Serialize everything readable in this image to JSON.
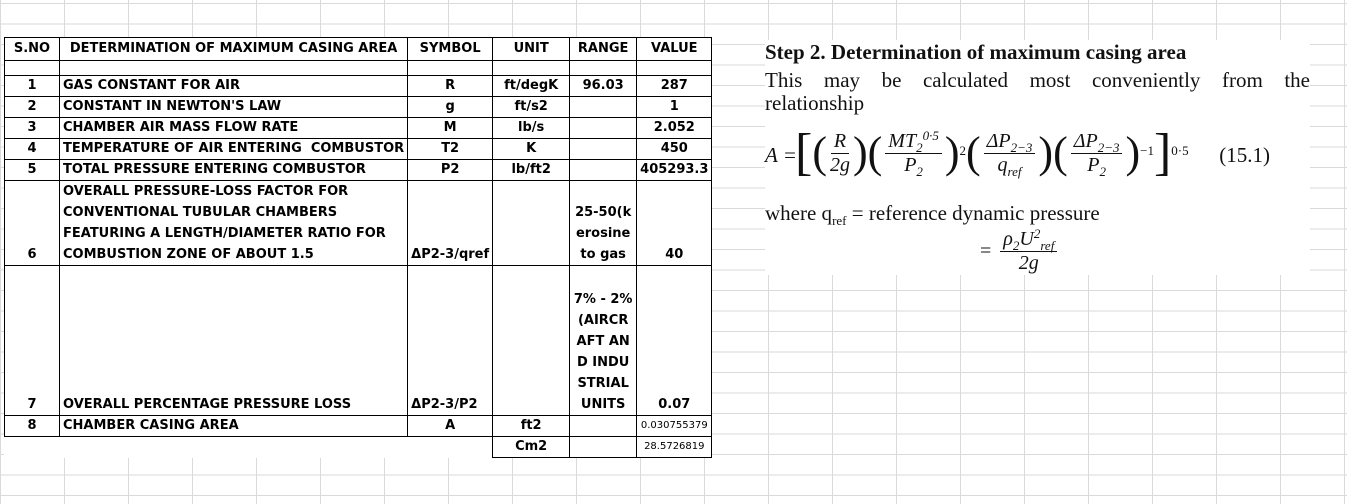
{
  "table": {
    "headers": {
      "sno": "S.NO",
      "description": "DETERMINATION OF MAXIMUM CASING AREA",
      "symbol": "SYMBOL",
      "unit": "UNIT",
      "range": "RANGE",
      "value": "VALUE"
    },
    "rows": [
      {
        "sno": "1",
        "description": "GAS CONSTANT FOR AIR",
        "symbol": "R",
        "unit": "ft/degK",
        "range": "96.03",
        "value": "287"
      },
      {
        "sno": "2",
        "description": "CONSTANT IN NEWTON'S LAW",
        "symbol": "g",
        "unit": "ft/s2",
        "range": "",
        "value": "1"
      },
      {
        "sno": "3",
        "description": "CHAMBER AIR MASS FLOW RATE",
        "symbol": "M",
        "unit": "lb/s",
        "range": "",
        "value": "2.052"
      },
      {
        "sno": "4",
        "description": "TEMPERATURE OF AIR ENTERING  COMBUSTOR",
        "symbol": "T2",
        "unit": "K",
        "range": "",
        "value": "450"
      },
      {
        "sno": "5",
        "description": "TOTAL PRESSURE ENTERING COMBUSTOR",
        "symbol": "P2",
        "unit": "lb/ft2",
        "range": "",
        "value": "405293.3"
      },
      {
        "sno": "6",
        "description": "OVERALL PRESSURE-LOSS FACTOR FOR CONVENTIONAL TUBULAR CHAMBERS FEATURING A LENGTH/DIAMETER RATIO FOR COMBUSTION ZONE OF ABOUT 1.5",
        "symbol": "ΔP2-3/qref",
        "unit": "",
        "range": "25-50(kerosine to gas",
        "value": "40"
      },
      {
        "sno": "7",
        "description": "OVERALL PERCENTAGE PRESSURE LOSS",
        "symbol": "ΔP2-3/P2",
        "unit": "",
        "range": "7% - 2%(AIRCRAFT AND INDUSTRIAL UNITS",
        "value": "0.07"
      },
      {
        "sno": "8",
        "description": "CHAMBER CASING AREA",
        "symbol": "A",
        "unit": "ft2",
        "range": "",
        "value": "0.030755379"
      }
    ],
    "extra_row": {
      "unit": "Cm2",
      "value": "28.5726819"
    }
  },
  "doc": {
    "heading": "Step 2. Determination of maximum casing area",
    "intro": "This may be calculated most conveniently from the relationship",
    "lhs": "A =",
    "equation_number": "(15.1)",
    "where_text": "where q",
    "where_sub": "ref",
    "where_rest": " = reference dynamic pressure"
  }
}
